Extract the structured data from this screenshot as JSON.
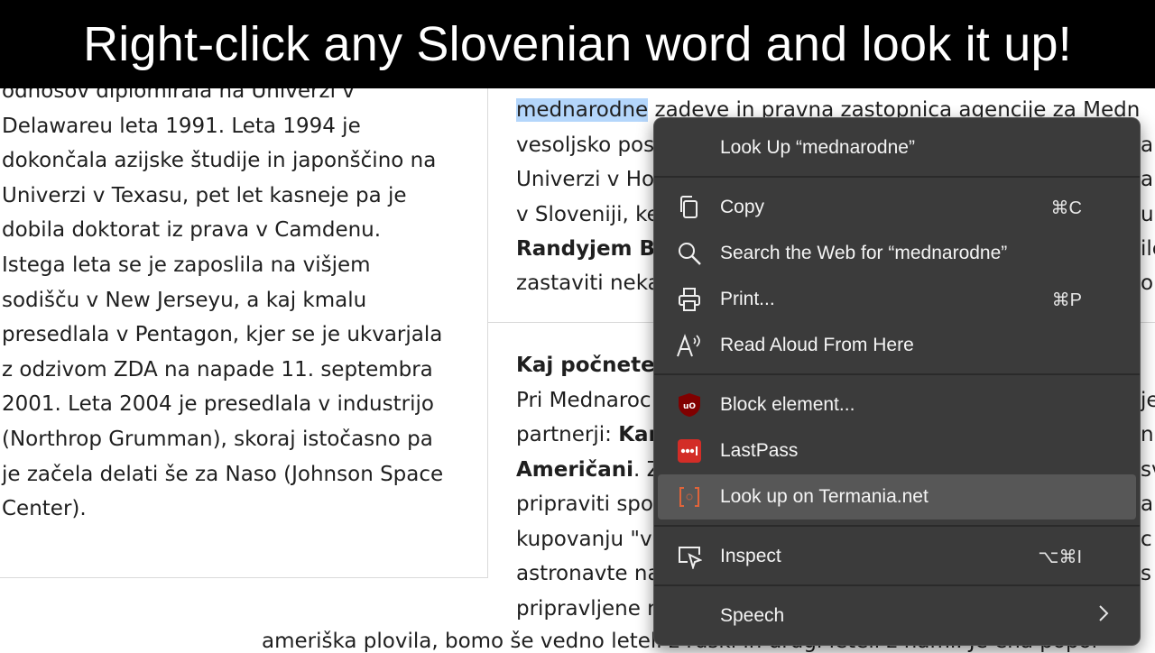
{
  "banner": {
    "text": "Right-click any Slovenian word and look it up!"
  },
  "left_column": {
    "lines": [
      "odnosov diplomirala na Univerzi v",
      "Delawareu leta 1991. Leta 1994 je",
      "dokončala azijske študije in japonščino na",
      "Univerzi v Texasu, pet let kasneje pa je",
      "dobila doktorat iz prava v Camdenu.",
      "Istega leta se je zaposlila na višjem",
      "sodišču v New Jerseyu, a kaj kmalu",
      "presedlala v Pentagon, kjer se je ukvarjala",
      "z odzivom ZDA na napade 11. septembra",
      "2001. Leta 2004 je presedlala v industrijo",
      "(Northrop Grumman), skoraj istočasno pa",
      "je začela delati še za Naso (Johnson Space",
      "Center)."
    ]
  },
  "right_column": {
    "selected_word": "mednarodne",
    "line1_rest": " zadeve in pravna zastopnica agencije za Medn",
    "line2": "vesoljsko pos",
    "line3": "Univerzi v Ho",
    "line4": "v Sloveniji, ke",
    "line5_bold": "Randyjem B",
    "line6": "zastaviti neka",
    "heading_bold": "Kaj počnete",
    "line7": "Pri Mednaroc",
    "line8_normal": "partnerji: ",
    "line8_bold": "Kar",
    "line9_bold": "Američani",
    "line9_rest": ". Z",
    "line10": "pripraviti spo",
    "line11": "kupovanju \"v",
    "line12": "astronavte na",
    "line13": "pripravljene n",
    "right_edge": [
      "a",
      "a",
      "u",
      "ile",
      "o",
      "je",
      "n",
      "sv",
      "a",
      "c",
      "s"
    ]
  },
  "bottom_line": "ameriška plovila, bomo še vedno leteli z ruski in drugi leteli z nami. Je ena popol",
  "context_menu": {
    "lookup_label": "Look Up “mednarodne”",
    "copy_label": "Copy",
    "copy_shortcut": "⌘C",
    "search_label": "Search the Web for “mednarodne”",
    "print_label": "Print...",
    "print_shortcut": "⌘P",
    "read_aloud_label": "Read Aloud From Here",
    "block_label": "Block element...",
    "lastpass_label": "LastPass",
    "termania_label": "Look up on Termania.net",
    "inspect_label": "Inspect",
    "inspect_shortcut": "⌥⌘I",
    "speech_label": "Speech",
    "icons": {
      "copy": "copy-icon",
      "search": "search-icon",
      "print": "printer-icon",
      "read_aloud": "read-aloud-icon",
      "block": "ublock-icon",
      "lastpass": "lastpass-icon",
      "termania": "termania-icon",
      "inspect": "inspect-icon",
      "speech_arrow": "chevron-right-icon"
    },
    "colors": {
      "menu_bg": "#3b3b3b",
      "hover_bg": "#575757",
      "ublock": "#800000",
      "lastpass": "#d32d27",
      "termania": "#e0643a"
    }
  }
}
